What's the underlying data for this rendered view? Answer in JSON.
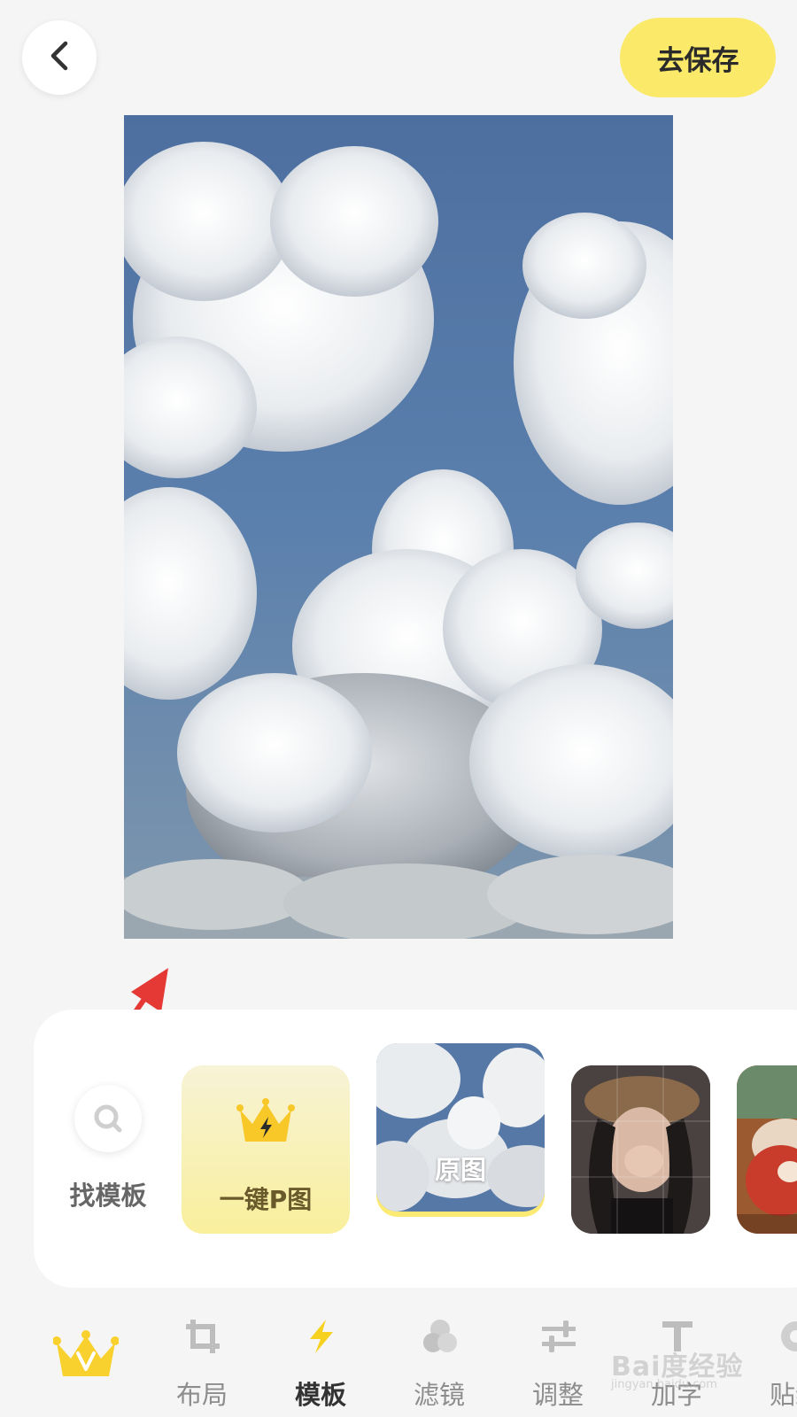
{
  "header": {
    "back_icon": "chevron-left-icon",
    "save_label": "去保存"
  },
  "template_panel": {
    "find_template_label": "找模板",
    "find_template_icon": "search-icon",
    "one_key_label": "一键P图",
    "one_key_icon": "crown-lightning-icon",
    "original_label": "原图"
  },
  "bottom_nav": {
    "vip_icon": "vip-crown-icon",
    "items": [
      {
        "label": "布局",
        "icon": "crop-icon"
      },
      {
        "label": "模板",
        "icon": "lightning-icon"
      },
      {
        "label": "滤镜",
        "icon": "filter-circles-icon"
      },
      {
        "label": "调整",
        "icon": "sliders-icon"
      },
      {
        "label": "加字",
        "icon": "text-icon"
      },
      {
        "label": "贴纸",
        "icon": "sticker-icon"
      }
    ]
  },
  "watermark": {
    "text": "Bai度经验",
    "sub": "jingyan.baidu.com"
  },
  "colors": {
    "accent_yellow": "#fbe96a",
    "arrow_red": "#e53935"
  }
}
